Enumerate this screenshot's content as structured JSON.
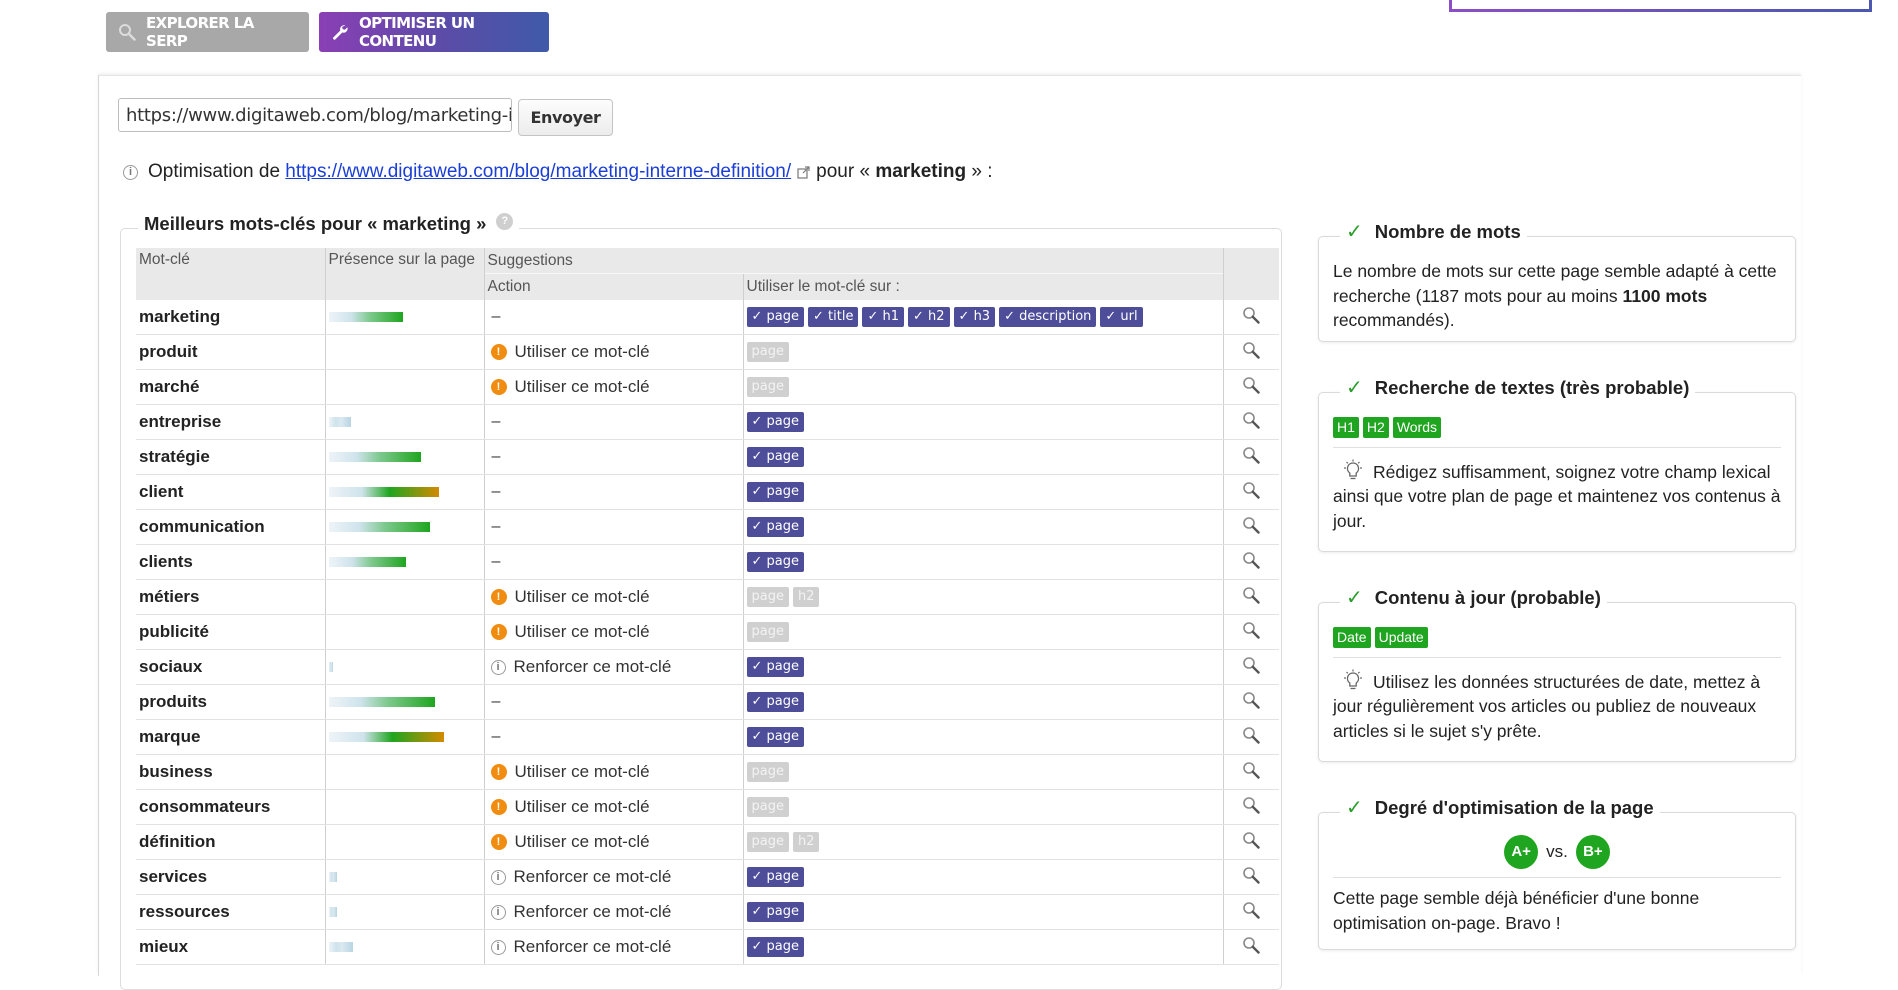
{
  "toolbar": {
    "explore_label": "EXPLORER LA SERP",
    "optimize_label": "OPTIMISER UN CONTENU"
  },
  "form": {
    "url_value": "https://www.digitaweb.com/blog/marketing-interne-definition/",
    "send_label": "Envoyer"
  },
  "optimization_line": {
    "prefix": "Optimisation de",
    "url": "https://www.digitaweb.com/blog/marketing-interne-definition/",
    "middle": "pour «",
    "keyword": "marketing",
    "suffix": "» :"
  },
  "keywords_panel": {
    "title": "Meilleurs mots-clés pour « marketing »",
    "help": "?",
    "headers": {
      "keyword": "Mot-clé",
      "presence": "Présence sur la page",
      "suggestions": "Suggestions",
      "action": "Action",
      "use_on": "Utiliser le mot-clé sur :"
    },
    "rows": [
      {
        "kw": "marketing",
        "presence": 0.62,
        "action": "–",
        "action_type": "none",
        "tags": [
          [
            "✓ page",
            1
          ],
          [
            "✓ title",
            1
          ],
          [
            "✓ h1",
            1
          ],
          [
            "✓ h2",
            1
          ],
          [
            "✓ h3",
            1
          ],
          [
            "✓ description",
            1
          ],
          [
            "✓ url",
            1
          ]
        ]
      },
      {
        "kw": "produit",
        "presence": 0,
        "action": "Utiliser ce mot-clé",
        "action_type": "warn",
        "tags": [
          [
            "page",
            0
          ]
        ]
      },
      {
        "kw": "marché",
        "presence": 0,
        "action": "Utiliser ce mot-clé",
        "action_type": "warn",
        "tags": [
          [
            "page",
            0
          ]
        ]
      },
      {
        "kw": "entreprise",
        "presence": 0.18,
        "action": "–",
        "action_type": "none",
        "tags": [
          [
            "✓ page",
            1
          ]
        ]
      },
      {
        "kw": "stratégie",
        "presence": 0.77,
        "action": "–",
        "action_type": "none",
        "tags": [
          [
            "✓ page",
            1
          ]
        ]
      },
      {
        "kw": "client",
        "presence": 0.92,
        "action": "–",
        "action_type": "none",
        "tags": [
          [
            "✓ page",
            1
          ]
        ]
      },
      {
        "kw": "communication",
        "presence": 0.84,
        "action": "–",
        "action_type": "none",
        "tags": [
          [
            "✓ page",
            1
          ]
        ]
      },
      {
        "kw": "clients",
        "presence": 0.64,
        "action": "–",
        "action_type": "none",
        "tags": [
          [
            "✓ page",
            1
          ]
        ]
      },
      {
        "kw": "métiers",
        "presence": 0,
        "action": "Utiliser ce mot-clé",
        "action_type": "warn",
        "tags": [
          [
            "page",
            0
          ],
          [
            "h2",
            0
          ]
        ]
      },
      {
        "kw": "publicité",
        "presence": 0,
        "action": "Utiliser ce mot-clé",
        "action_type": "warn",
        "tags": [
          [
            "page",
            0
          ]
        ]
      },
      {
        "kw": "sociaux",
        "presence": 0.03,
        "action": "Renforcer ce mot-clé",
        "action_type": "info",
        "tags": [
          [
            "✓ page",
            1
          ]
        ]
      },
      {
        "kw": "produits",
        "presence": 0.88,
        "action": "–",
        "action_type": "none",
        "tags": [
          [
            "✓ page",
            1
          ]
        ]
      },
      {
        "kw": "marque",
        "presence": 0.96,
        "action": "–",
        "action_type": "none",
        "tags": [
          [
            "✓ page",
            1
          ]
        ]
      },
      {
        "kw": "business",
        "presence": 0,
        "action": "Utiliser ce mot-clé",
        "action_type": "warn",
        "tags": [
          [
            "page",
            0
          ]
        ]
      },
      {
        "kw": "consommateurs",
        "presence": 0,
        "action": "Utiliser ce mot-clé",
        "action_type": "warn",
        "tags": [
          [
            "page",
            0
          ]
        ]
      },
      {
        "kw": "définition",
        "presence": 0,
        "action": "Utiliser ce mot-clé",
        "action_type": "warn",
        "tags": [
          [
            "page",
            0
          ],
          [
            "h2",
            0
          ]
        ]
      },
      {
        "kw": "services",
        "presence": 0.07,
        "action": "Renforcer ce mot-clé",
        "action_type": "info",
        "tags": [
          [
            "✓ page",
            1
          ]
        ]
      },
      {
        "kw": "ressources",
        "presence": 0.07,
        "action": "Renforcer ce mot-clé",
        "action_type": "info",
        "tags": [
          [
            "✓ page",
            1
          ]
        ]
      },
      {
        "kw": "mieux",
        "presence": 0.2,
        "action": "Renforcer ce mot-clé",
        "action_type": "info",
        "tags": [
          [
            "✓ page",
            1
          ]
        ]
      }
    ]
  },
  "cards": {
    "word_count": {
      "check": "✓",
      "title": "Nombre de mots",
      "text_before": "Le nombre de mots sur cette page semble adapté à cette recherche (1187 mots pour au moins ",
      "text_bold": "1100 mots",
      "text_after": " recommandés)."
    },
    "text_search": {
      "check": "✓",
      "title": "Recherche de textes (très probable)",
      "tags": [
        "H1",
        "H2",
        "Words"
      ],
      "tip": "Rédigez suffisamment, soignez votre champ lexical ainsi que votre plan de page et maintenez vos contenus à jour."
    },
    "fresh_content": {
      "check": "✓",
      "title": "Contenu à jour (probable)",
      "tags": [
        "Date",
        "Update"
      ],
      "tip": "Utilisez les données structurées de date, mettez à jour régulièrement vos articles ou publiez de nouveaux articles si le sujet s'y prête."
    },
    "optimization_degree": {
      "check": "✓",
      "title": "Degré d'optimisation de la page",
      "grade_page": "A+",
      "vs": "vs.",
      "grade_serp": "B+",
      "text": "Cette page semble déjà bénéficier d'une bonne optimisation on-page. Bravo !"
    }
  },
  "colors": {
    "accent_purple": "#5b4ca8",
    "tag_on": "#4d4d9a",
    "tag_off": "#d0d0d0",
    "green_check": "#2a9d2a",
    "warn_orange": "#f08c0f",
    "link_blue": "#1a3ed6"
  }
}
